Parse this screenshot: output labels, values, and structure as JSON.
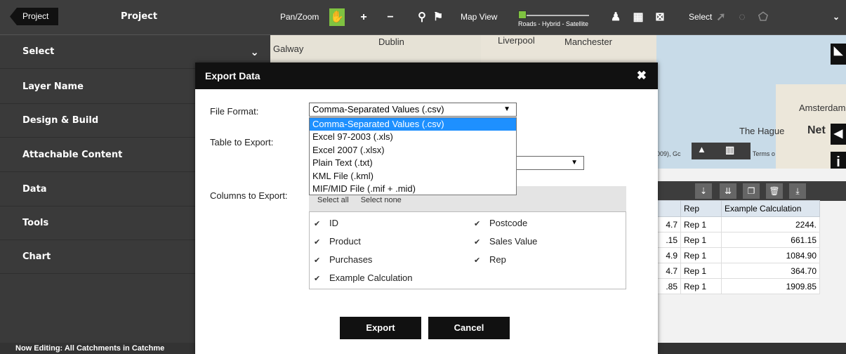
{
  "topbar": {
    "project_button": "Project",
    "project_title": "Project",
    "pan_zoom_label": "Pan/Zoom",
    "map_view_label": "Map View",
    "map_view_slider_text": "Roads - Hybrid - Satellite",
    "select_label": "Select"
  },
  "sidebar": {
    "items": [
      {
        "label": "Select"
      },
      {
        "label": "Layer Name"
      },
      {
        "label": "Design & Build"
      },
      {
        "label": "Attachable Content"
      },
      {
        "label": "Data"
      },
      {
        "label": "Tools"
      },
      {
        "label": "Chart"
      }
    ]
  },
  "status_bar": "Now Editing: All Catchments in Catchme",
  "map": {
    "labels": [
      "Galway",
      "Dublin",
      "Liverpool",
      "Manchester",
      "Amsterdam",
      "The Hague",
      "Net"
    ],
    "attribution_left": "009), Gc",
    "attribution_right": "r. Nacional   Terms o"
  },
  "table": {
    "headers": [
      "",
      "Rep",
      "Example Calculation"
    ],
    "rows": [
      [
        "4.7",
        "Rep 1",
        "2244."
      ],
      [
        ".15",
        "Rep 1",
        "661.15"
      ],
      [
        "4.9",
        "Rep 1",
        "1084.90"
      ],
      [
        "4.7",
        "Rep 1",
        "364.70"
      ],
      [
        ".85",
        "Rep 1",
        "1909.85"
      ]
    ]
  },
  "modal": {
    "title": "Export Data",
    "file_format_label": "File Format:",
    "file_format_value": "Comma-Separated Values (.csv)",
    "file_format_options": [
      "Comma-Separated Values (.csv)",
      "Excel 97-2003 (.xls)",
      "Excel 2007 (.xlsx)",
      "Plain Text (.txt)",
      "KML File (.kml)",
      "MIF/MID File (.mif + .mid)"
    ],
    "table_label": "Table to Export:",
    "columns_label": "Columns to Export:",
    "select_all": "Select all",
    "select_none": "Select none",
    "columns": [
      "ID",
      "Postcode",
      "Product",
      "Sales Value",
      "Purchases",
      "Rep",
      "Example Calculation"
    ],
    "export_button": "Export",
    "cancel_button": "Cancel"
  },
  "colors": {
    "accent": "#7fc241",
    "dropdown_selected": "#1e90ff",
    "header_dark": "#111111"
  }
}
